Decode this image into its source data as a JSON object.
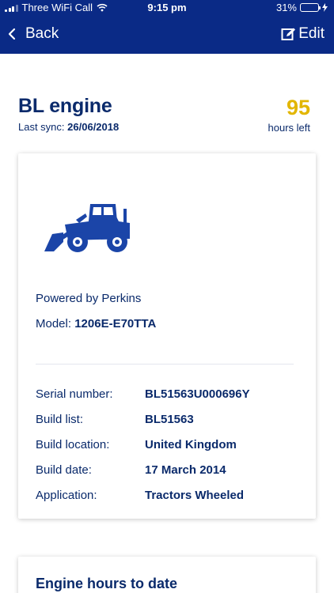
{
  "status_bar": {
    "carrier": "Three WiFi Call",
    "time": "9:15 pm",
    "battery_percent": "31%",
    "battery_level": 0.31,
    "battery_color": "#3ad34c"
  },
  "nav": {
    "back_label": "Back",
    "edit_label": "Edit",
    "bar_color": "#0a2a86"
  },
  "engine": {
    "title": "BL engine",
    "last_sync_label": "Last sync:",
    "last_sync_value": "26/06/2018",
    "hours_value": "95",
    "hours_label": "hours left",
    "hours_color": "#e2b600"
  },
  "details": {
    "image_icon": "wheel-loader-icon",
    "powered_by": "Powered by Perkins",
    "model_label": "Model:",
    "model_value": "1206E-E70TTA",
    "specs": [
      {
        "label": "Serial number:",
        "value": "BL51563U000696Y"
      },
      {
        "label": "Build list:",
        "value": "BL51563"
      },
      {
        "label": "Build location:",
        "value": "United Kingdom"
      },
      {
        "label": "Build date:",
        "value": "17 March 2014"
      },
      {
        "label": "Application:",
        "value": "Tractors Wheeled"
      }
    ]
  },
  "hours_card": {
    "title": "Engine hours to date"
  }
}
